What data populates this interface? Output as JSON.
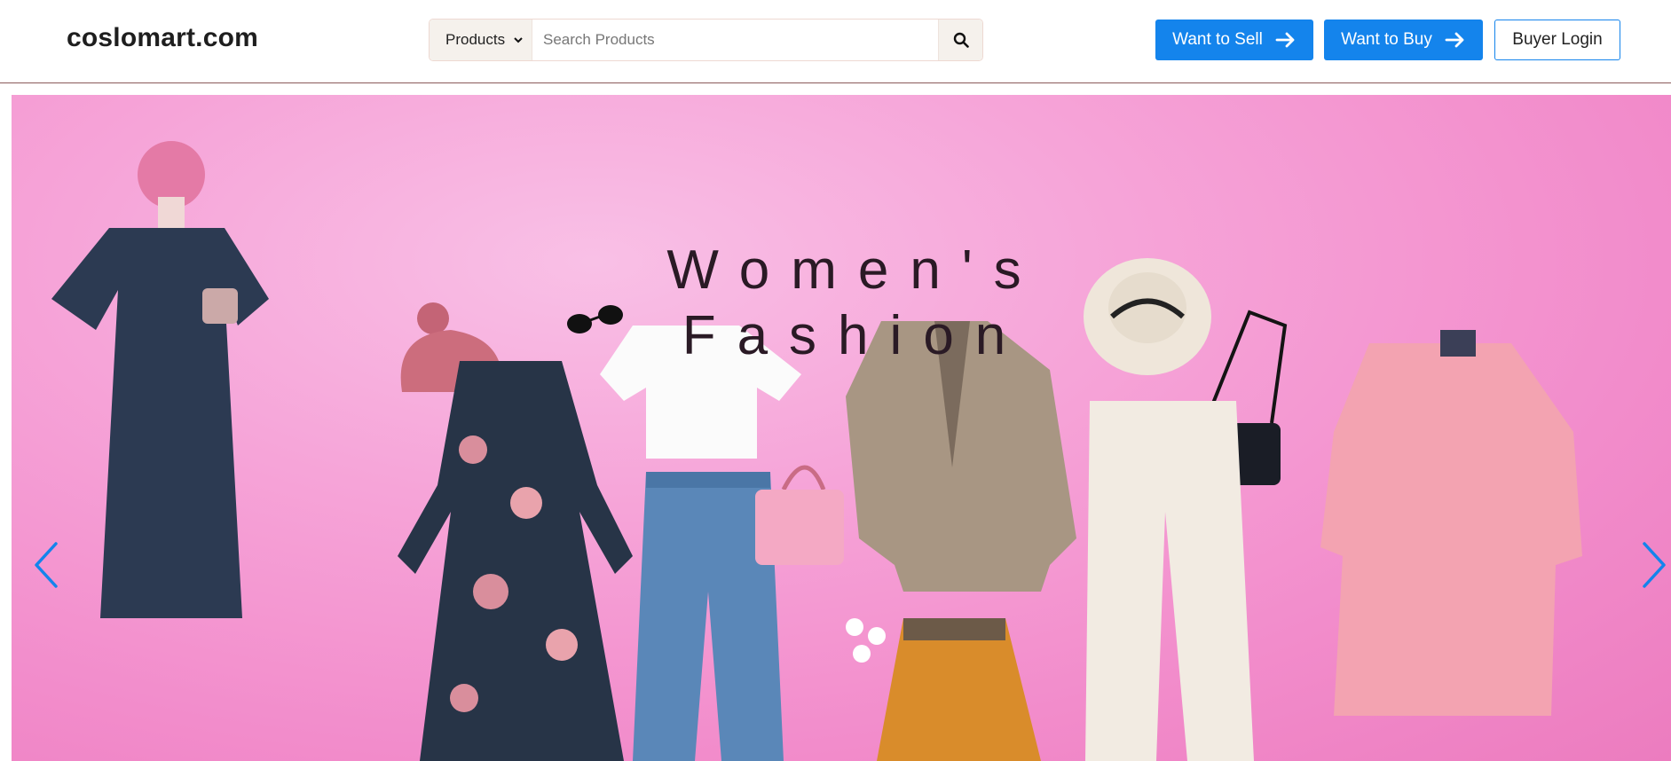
{
  "brand": {
    "name": "coslomart.com"
  },
  "search": {
    "category_selected": "Products",
    "placeholder": "Search Products",
    "value": ""
  },
  "nav": {
    "sell_label": "Want to Sell",
    "buy_label": "Want to Buy",
    "login_label": "Buyer Login"
  },
  "hero": {
    "title_line1": "Women's",
    "title_line2": "Fashion"
  },
  "icons": {
    "search": "search-icon",
    "arrow": "arrow-right-icon",
    "prev": "chevron-left-icon",
    "next": "chevron-right-icon"
  },
  "colors": {
    "accent": "#1484ec",
    "hero_bg": "#f28ccb"
  }
}
